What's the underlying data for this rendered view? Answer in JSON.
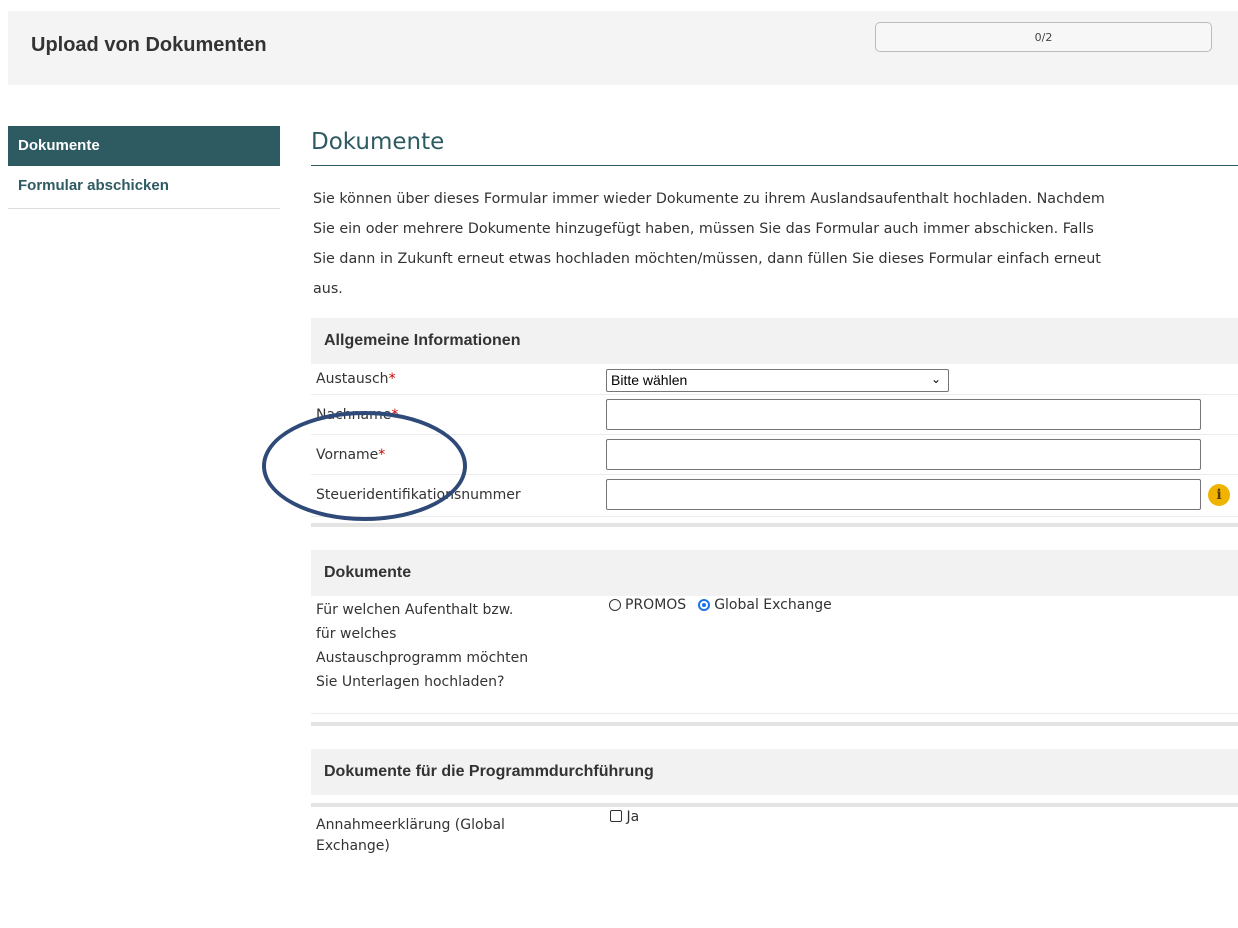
{
  "header": {
    "title": "Upload von Dokumenten",
    "progress": "0/2",
    "progress_value": 0
  },
  "sidebar": {
    "items": [
      {
        "label": "Dokumente",
        "active": true
      },
      {
        "label": "Formular abschicken",
        "active": false
      }
    ]
  },
  "main": {
    "title": "Dokumente",
    "intro_lines": [
      "Sie können über dieses Formular immer wieder Dokumente zu ihrem Auslandsaufenthalt hochladen. Nachdem",
      "Sie ein oder mehrere Dokumente hinzugefügt haben, müssen Sie das Formular auch immer abschicken. Falls",
      "Sie dann in Zukunft erneut etwas hochladen möchten/müssen, dann füllen Sie dieses Formular einfach erneut",
      "aus."
    ]
  },
  "section_general": {
    "title": "Allgemeine Informationen",
    "austausch_label": "Austausch",
    "austausch_value": "Bitte wählen",
    "nachname_label": "Nachname",
    "nachname_value": "",
    "vorname_label": "Vorname",
    "vorname_value": "",
    "steuer_label": "Steueridentifikationsnummer",
    "steuer_value": "",
    "required_mark": "*"
  },
  "section_documents": {
    "title": "Dokumente",
    "question_lines": [
      "Für welchen Aufenthalt bzw.",
      "für welches",
      "Austauschprogramm möchten",
      "Sie Unterlagen hochladen?"
    ],
    "options": [
      {
        "label": "PROMOS",
        "checked": false
      },
      {
        "label": "Global Exchange",
        "checked": true
      }
    ]
  },
  "section_program": {
    "title": "Dokumente für die Programmdurchführung",
    "item_lines": [
      "Annahmeerklärung (Global",
      "Exchange)"
    ],
    "checkbox_label": "Ja",
    "checkbox_checked": false
  },
  "colors": {
    "brand": "#2e5a62",
    "required": "#cc0000",
    "info_icon": "#f0b400",
    "annotation": "#2f4a78"
  }
}
